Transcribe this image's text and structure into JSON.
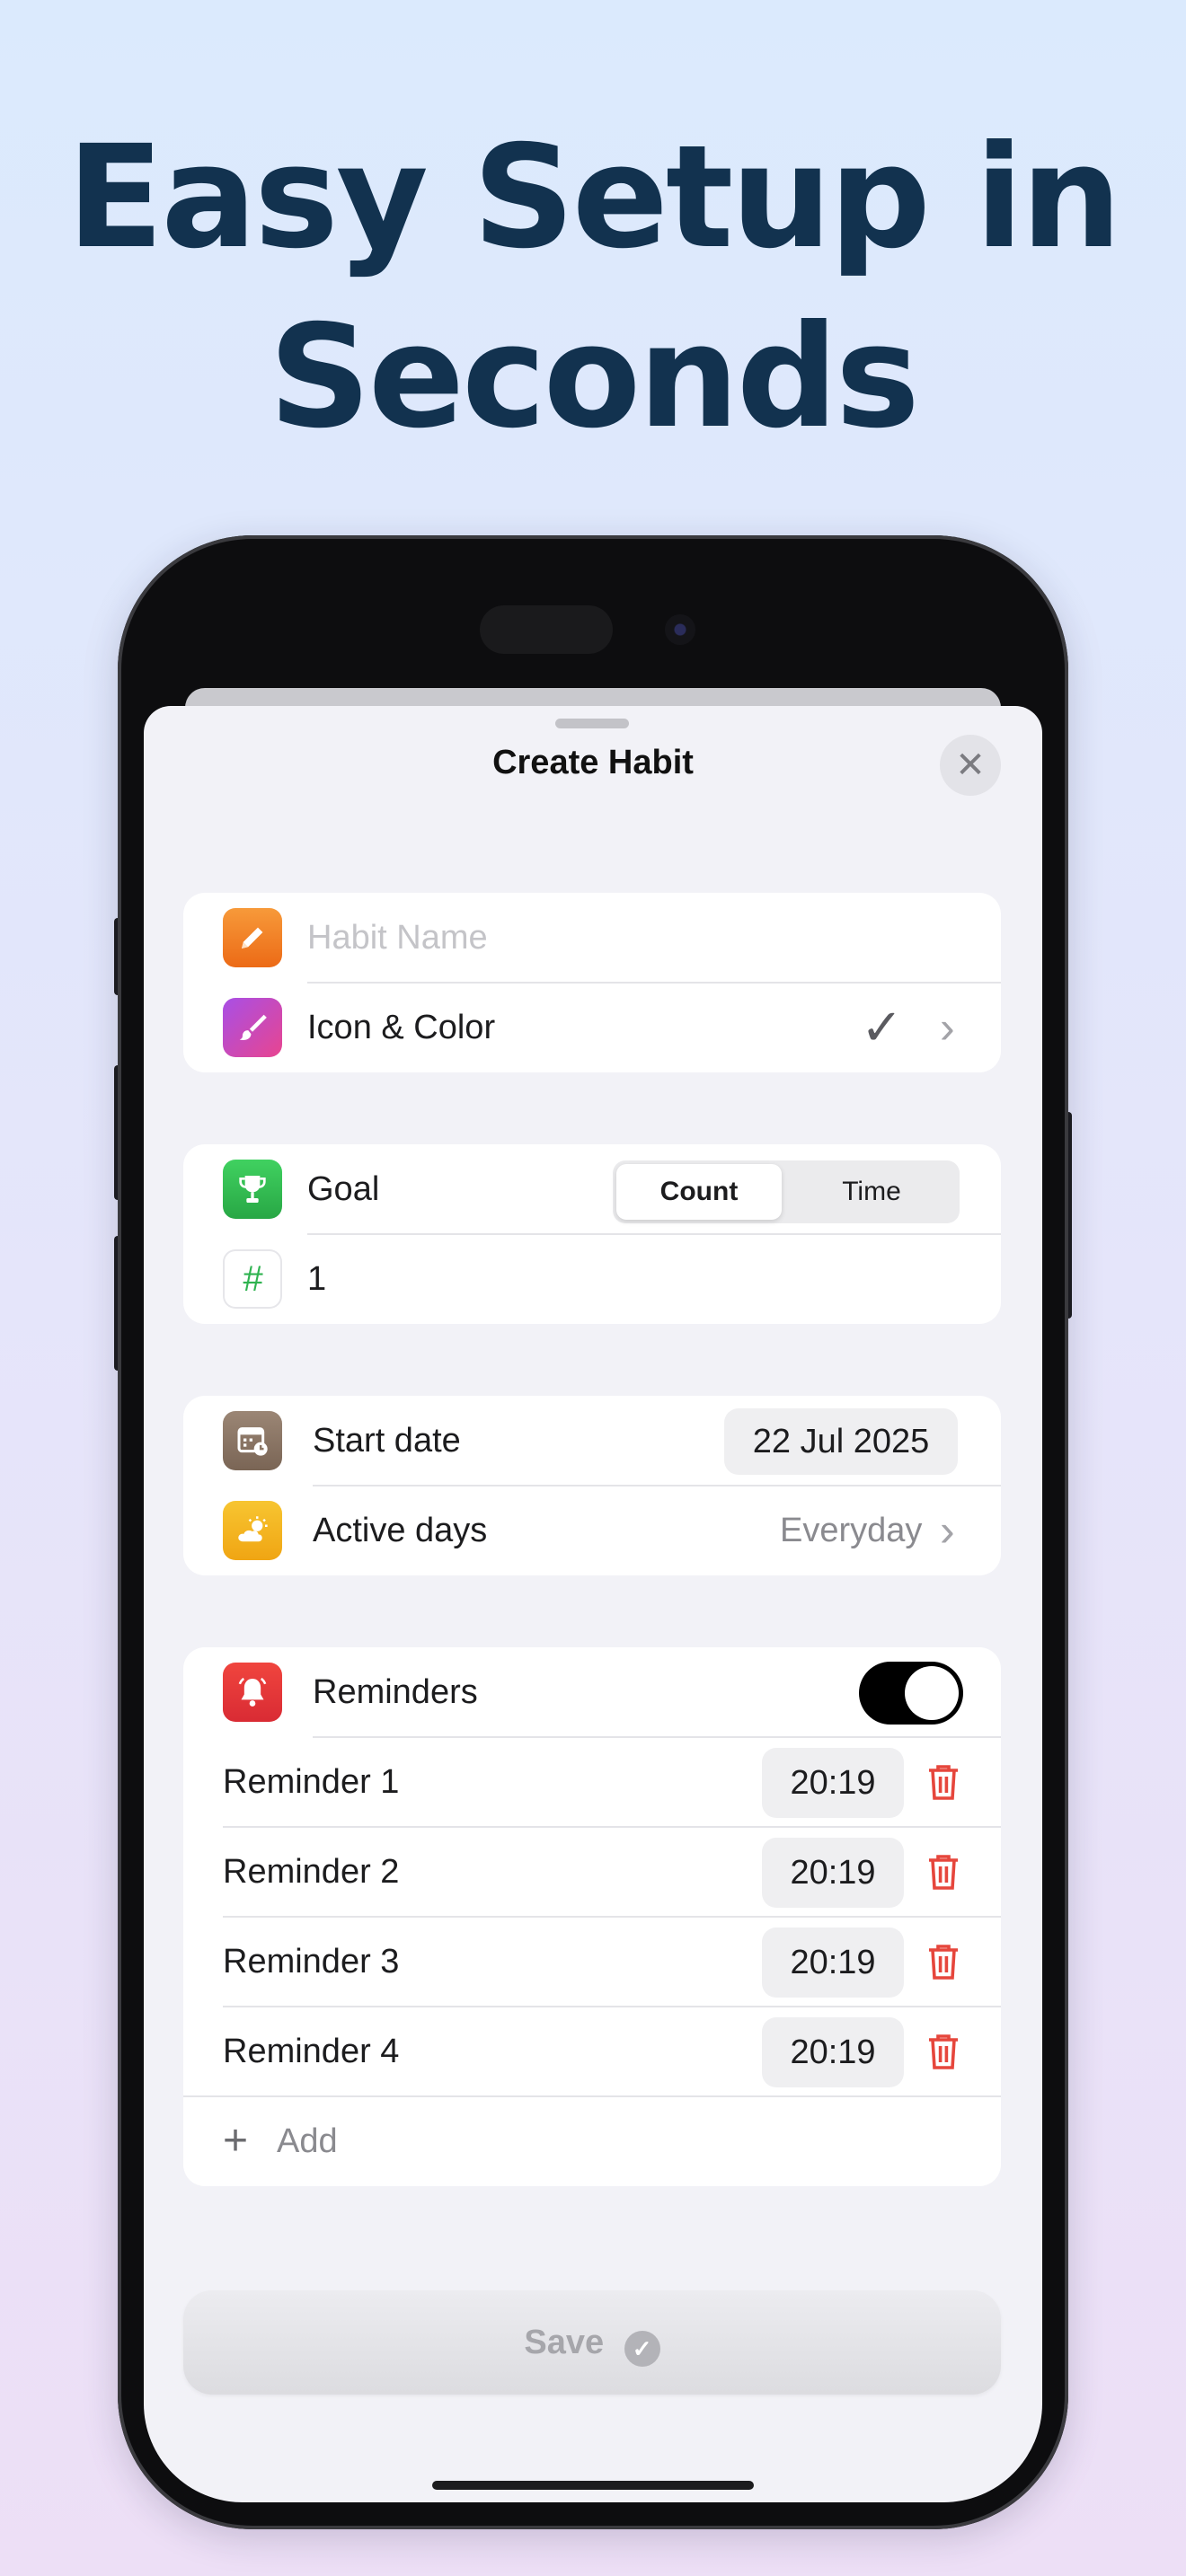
{
  "headline": {
    "line1": "Easy Setup in",
    "line2": "Seconds"
  },
  "sheet": {
    "title": "Create Habit",
    "close_icon": "close-icon"
  },
  "basics": {
    "name_placeholder": "Habit Name",
    "icon_color_label": "Icon & Color",
    "icon_check_glyph": "✓",
    "chevron": "›"
  },
  "goal": {
    "label": "Goal",
    "segments": [
      "Count",
      "Time"
    ],
    "selected": "Count",
    "hash_glyph": "#",
    "value": "1"
  },
  "schedule": {
    "start_label": "Start date",
    "start_value": "22 Jul 2025",
    "days_label": "Active days",
    "days_value": "Everyday",
    "chevron": "›"
  },
  "reminders": {
    "label": "Reminders",
    "enabled": true,
    "items": [
      {
        "label": "Reminder 1",
        "time": "20:19"
      },
      {
        "label": "Reminder 2",
        "time": "20:19"
      },
      {
        "label": "Reminder 3",
        "time": "20:19"
      },
      {
        "label": "Reminder 4",
        "time": "20:19"
      }
    ],
    "add_glyph": "+",
    "add_label": "Add"
  },
  "footer": {
    "save_label": "Save"
  },
  "colors": {
    "headline": "#12324f",
    "pencil_icon": "#f07a22",
    "brush_icon": "#c04fd9",
    "trophy_icon": "#34c759",
    "calendar_icon": "#8c7766",
    "weather_icon": "#f2b51d",
    "bell_icon": "#e8333a",
    "trash": "#e6463c"
  }
}
